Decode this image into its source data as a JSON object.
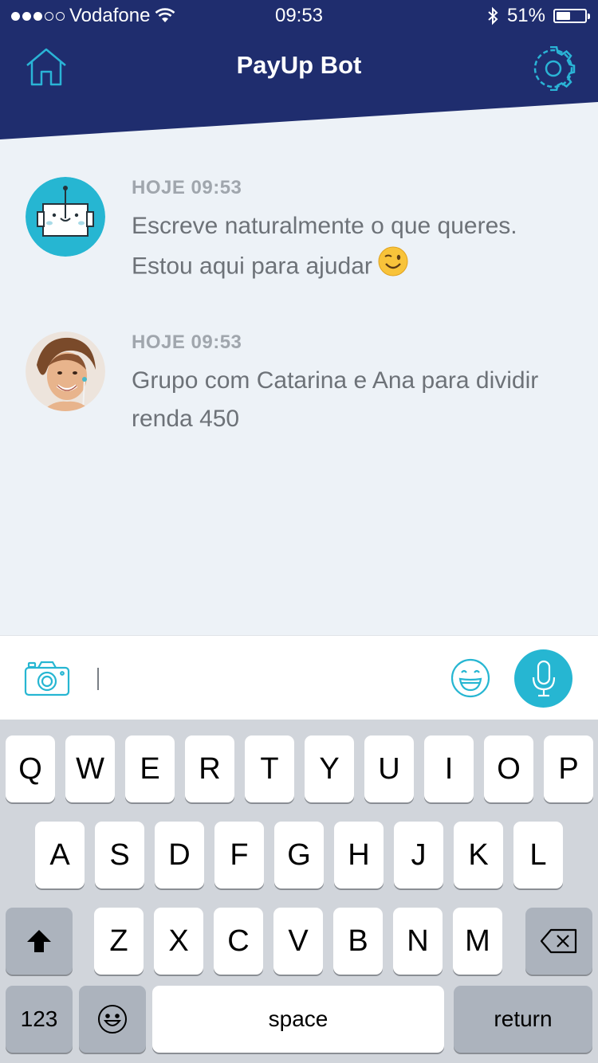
{
  "status_bar": {
    "carrier": "Vodafone",
    "time": "09:53",
    "battery": "51%",
    "battery_level": 0.51
  },
  "header": {
    "title": "PayUp Bot",
    "home_icon": "home-icon",
    "settings_icon": "gear-icon"
  },
  "messages": [
    {
      "sender": "bot",
      "timestamp": "HOJE 09:53",
      "text": "Escreve naturalmente o que queres. Estou aqui para ajudar",
      "emoji": "winking-face"
    },
    {
      "sender": "user",
      "timestamp": "HOJE 09:53",
      "text": "Grupo com Catarina e Ana para dividir renda 450"
    }
  ],
  "input": {
    "value": "",
    "camera_icon": "camera-icon",
    "emoji_icon": "smiley-icon",
    "mic_icon": "microphone-icon"
  },
  "keyboard": {
    "row1": [
      "Q",
      "W",
      "E",
      "R",
      "T",
      "Y",
      "U",
      "I",
      "O",
      "P"
    ],
    "row2": [
      "A",
      "S",
      "D",
      "F",
      "G",
      "H",
      "J",
      "K",
      "L"
    ],
    "row3": [
      "Z",
      "X",
      "C",
      "V",
      "B",
      "N",
      "M"
    ],
    "numbers_label": "123",
    "space_label": "space",
    "return_label": "return"
  },
  "colors": {
    "header_navy": "#1f2d6e",
    "accent_teal": "#26b6d2",
    "background": "#edf2f7"
  }
}
